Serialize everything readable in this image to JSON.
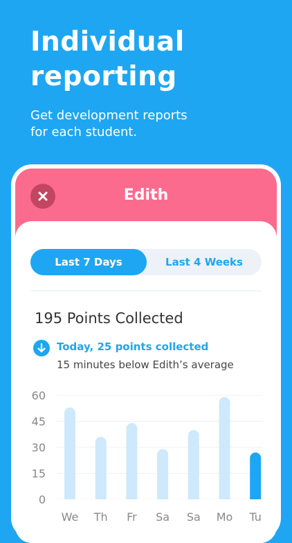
{
  "promo": {
    "headline_line1": "Individual",
    "headline_line2": "reporting",
    "subtitle_line1": "Get development reports",
    "subtitle_line2": "for each student."
  },
  "header": {
    "title": "Edith",
    "close_icon": "close-icon"
  },
  "tabs": [
    {
      "label": "Last 7 Days",
      "active": true
    },
    {
      "label": "Last 4 Weeks",
      "active": false
    }
  ],
  "summary": {
    "points": "195 Points Collected",
    "today": "Today, 25 points collected",
    "comparison": "15 minutes below Edith’s average",
    "icon": "arrow-down-circle-icon"
  },
  "colors": {
    "background": "#1ea6f2",
    "header": "#fb6b8d",
    "close_button": "#c2465f",
    "bar": "#cde9fb",
    "bar_highlight": "#1ea6f2"
  },
  "chart_data": {
    "type": "bar",
    "categories": [
      "We",
      "Th",
      "Fr",
      "Sa",
      "Sa",
      "Mo",
      "Tu"
    ],
    "values": [
      53,
      36,
      44,
      29,
      40,
      59,
      27
    ],
    "highlight_index": 6,
    "yticks": [
      0,
      15,
      30,
      45,
      60
    ],
    "ylim": [
      0,
      60
    ],
    "grid": true
  }
}
